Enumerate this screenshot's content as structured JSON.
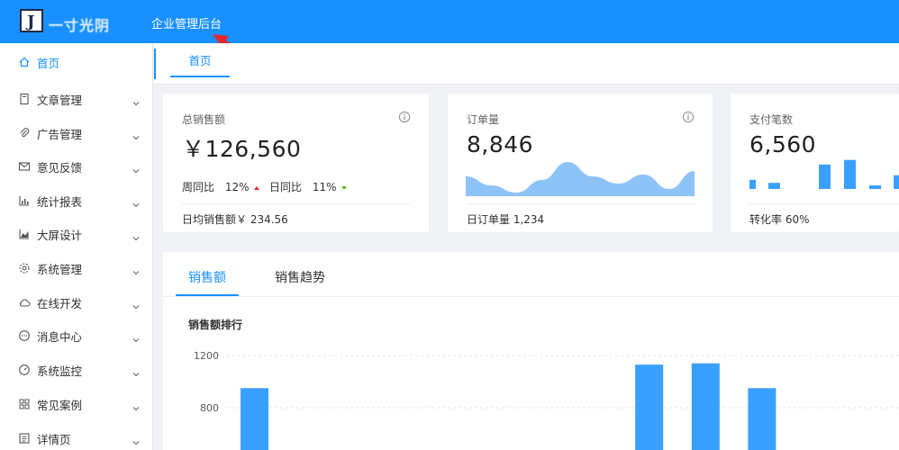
{
  "header": {
    "logo_letter": "J",
    "logo_text": "一寸光阴",
    "title": "企业管理后台"
  },
  "sidebar": {
    "items": [
      {
        "label": "首页",
        "icon": "home-icon",
        "active": true,
        "has_children": false
      },
      {
        "label": "文章管理",
        "icon": "document-icon",
        "has_children": true
      },
      {
        "label": "广告管理",
        "icon": "paperclip-icon",
        "has_children": true
      },
      {
        "label": "意见反馈",
        "icon": "mail-icon",
        "has_children": true
      },
      {
        "label": "统计报表",
        "icon": "bar-chart-icon",
        "has_children": true
      },
      {
        "label": "大屏设计",
        "icon": "area-chart-icon",
        "has_children": true
      },
      {
        "label": "系统管理",
        "icon": "gear-icon",
        "has_children": true
      },
      {
        "label": "在线开发",
        "icon": "cloud-icon",
        "has_children": true
      },
      {
        "label": "消息中心",
        "icon": "message-icon",
        "has_children": true
      },
      {
        "label": "系统监控",
        "icon": "dashboard-icon",
        "has_children": true
      },
      {
        "label": "常见案例",
        "icon": "grid-icon",
        "has_children": true
      },
      {
        "label": "详情页",
        "icon": "detail-icon",
        "has_children": true
      }
    ]
  },
  "tabs": {
    "home": "首页"
  },
  "cards": {
    "sales": {
      "title": "总销售额",
      "value": "￥126,560",
      "weekly_label": "周同比",
      "weekly_value": "12%",
      "daily_label": "日同比",
      "daily_value": "11%",
      "footer": "日均销售额￥ 234.56"
    },
    "orders": {
      "title": "订单量",
      "value": "8,846",
      "footer": "日订单量 1,234",
      "sparkline": [
        0.55,
        0.3,
        0.1,
        0.45,
        0.95,
        0.55,
        0.35,
        0.6,
        0.2,
        0.7
      ]
    },
    "payments": {
      "title": "支付笔数",
      "value": "6,560",
      "footer": "转化率 60%",
      "bars": [
        0.3,
        0.2,
        0.8,
        0.95,
        0.1,
        0.45
      ]
    }
  },
  "panel": {
    "tab_sales": "销售额",
    "tab_trend": "销售趋势",
    "rank_title": "销售额排行"
  },
  "chart_data": {
    "type": "bar",
    "title": "销售额排行",
    "yticks": [
      "1200",
      "800"
    ],
    "ylim": [
      0,
      1200
    ],
    "categories": [
      "",
      "",
      "",
      "",
      "",
      "",
      "",
      "",
      "",
      ""
    ],
    "values": [
      950,
      0,
      0,
      0,
      0,
      0,
      0,
      1130,
      1140,
      950
    ],
    "grid": true,
    "colors": {
      "bar": "#3aa0ff",
      "accent": "#1890ff"
    }
  }
}
